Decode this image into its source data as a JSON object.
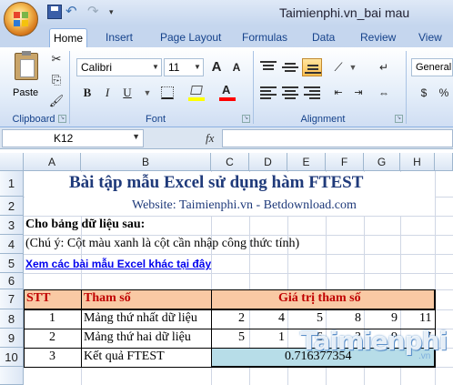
{
  "window": {
    "title": "Taimienphi.vn_bai mau"
  },
  "quick_access": {
    "save_icon": "save-icon",
    "undo_icon": "undo-icon",
    "redo_icon": "redo-icon",
    "undo_glyph": "↶",
    "redo_glyph": "↷",
    "more_glyph": "▾"
  },
  "tabs": [
    "Home",
    "Insert",
    "Page Layout",
    "Formulas",
    "Data",
    "Review",
    "View"
  ],
  "ribbon": {
    "clipboard": {
      "label": "Clipboard",
      "paste": "Paste"
    },
    "font": {
      "label": "Font",
      "name": "Calibri",
      "size": "11",
      "grow": "A",
      "shrink": "A",
      "bold": "B",
      "italic": "I",
      "underline": "U",
      "fill_color": "#ffff00",
      "font_color": "#ff0000"
    },
    "alignment": {
      "label": "Alignment"
    },
    "number": {
      "format": "General"
    }
  },
  "formula_bar": {
    "name_box": "K12",
    "fx": "fx",
    "value": ""
  },
  "columns": [
    "A",
    "B",
    "C",
    "D",
    "E",
    "F",
    "G",
    "H"
  ],
  "rows": [
    "1",
    "2",
    "3",
    "4",
    "5",
    "6",
    "7",
    "8",
    "9",
    "10"
  ],
  "sheet": {
    "title": "Bài tập mẫu Excel sử dụng hàm FTEST",
    "website": "Website: Taimienphi.vn - Betdownload.com",
    "data_heading": "Cho bảng dữ liệu sau:",
    "note": "(Chú ý: Cột màu xanh là cột cần nhập công thức tính)",
    "link": "Xem các bài mẫu Excel khác tại đây",
    "table": {
      "headers": {
        "stt": "STT",
        "param": "Tham số",
        "values": "Giá trị tham số"
      },
      "rows": [
        {
          "stt": "1",
          "name": "Mảng thứ nhất dữ liệu",
          "values": [
            "2",
            "4",
            "5",
            "8",
            "9",
            "11"
          ]
        },
        {
          "stt": "2",
          "name": "Mảng thứ hai dữ liệu",
          "values": [
            "5",
            "1",
            "6",
            "3",
            "9",
            "7"
          ]
        },
        {
          "stt": "3",
          "name": "Kết quả FTEST",
          "result": "0.716377354"
        }
      ]
    }
  },
  "watermark": {
    "text": "Taimienphi",
    "suffix": ".vn"
  },
  "colors": {
    "accent": "#1f3a7a",
    "header_fill": "#f9c9a4",
    "result_fill": "#b7dde8",
    "header_text": "#c00000",
    "link": "#0000ee"
  }
}
